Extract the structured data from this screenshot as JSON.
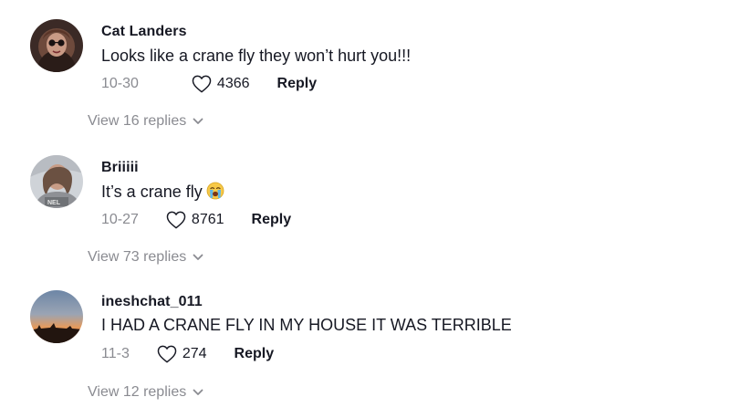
{
  "comments": [
    {
      "username": "Cat Landers",
      "text": "Looks like a crane fly they won’t hurt you!!!",
      "date": "10-30",
      "likes": "4366",
      "reply_label": "Reply",
      "view_replies": "View 16 replies"
    },
    {
      "username": "Briiiii",
      "text": "It’s a crane fly",
      "emoji": "loudly-crying-face",
      "date": "10-27",
      "likes": "8761",
      "reply_label": "Reply",
      "view_replies": "View 73 replies"
    },
    {
      "username": "ineshchat_011",
      "text": "I HAD A CRANE FLY IN MY HOUSE IT WAS TERRIBLE",
      "date": "11-3",
      "likes": "274",
      "reply_label": "Reply",
      "view_replies": "View 12 replies"
    }
  ],
  "icons": {
    "like": "heart-outline-icon",
    "expand": "chevron-down-icon"
  },
  "colors": {
    "primary_text": "#161823",
    "secondary_text": "#8a8b91"
  }
}
